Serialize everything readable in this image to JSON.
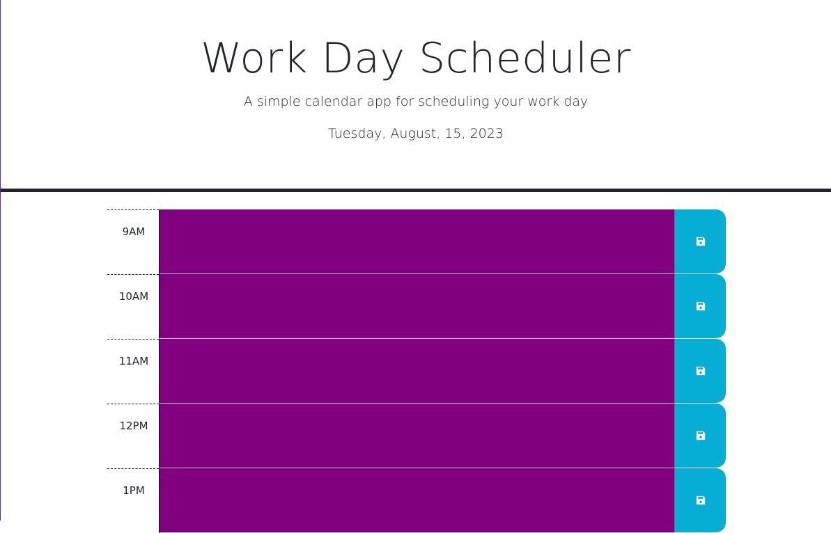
{
  "header": {
    "title": "Work Day Scheduler",
    "subtitle": "A simple calendar app for scheduling your work day",
    "current_day": "Tuesday, August, 15, 2023"
  },
  "time_blocks": [
    {
      "hour": "9AM",
      "description": "",
      "status": "present",
      "color": "#800080"
    },
    {
      "hour": "10AM",
      "description": "",
      "status": "present",
      "color": "#800080"
    },
    {
      "hour": "11AM",
      "description": "",
      "status": "present",
      "color": "#800080"
    },
    {
      "hour": "12PM",
      "description": "",
      "status": "present",
      "color": "#800080"
    },
    {
      "hour": "1PM",
      "description": "",
      "status": "present",
      "color": "#800080"
    }
  ],
  "save_button": {
    "icon": "floppy-disk-icon",
    "color": "#06aed5"
  }
}
